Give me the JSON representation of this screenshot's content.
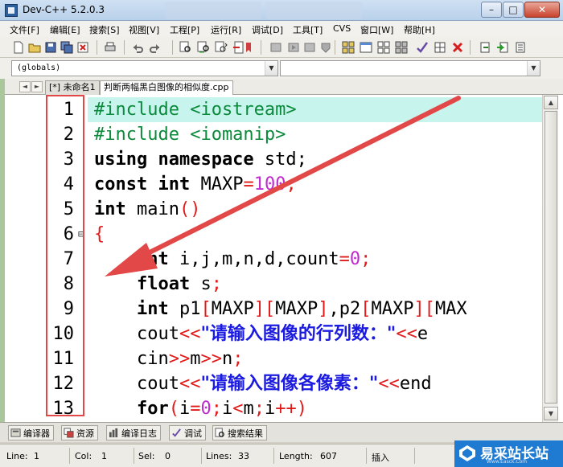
{
  "window": {
    "title": "Dev-C++ 5.2.0.3",
    "controls": {
      "minimize": "–",
      "maximize": "□",
      "close": "✕"
    }
  },
  "menu": [
    "文件[F]",
    "编辑[E]",
    "搜索[S]",
    "视图[V]",
    "工程[P]",
    "运行[R]",
    "调试[D]",
    "工具[T]",
    "CVS",
    "窗口[W]",
    "帮助[H]"
  ],
  "toolbar_icons": [
    "new-file-icon",
    "open-file-icon",
    "save-icon",
    "save-all-icon",
    "close-file-icon",
    "print-icon",
    "undo-icon",
    "redo-icon",
    "find-icon",
    "replace-icon",
    "find-next-icon",
    "goto-line-icon",
    "compile-icon",
    "run-icon",
    "compile-run-icon",
    "rebuild-icon",
    "new-project-icon",
    "add-file-icon",
    "remove-file-icon",
    "project-options-icon",
    "check-icon",
    "stop-icon",
    "debug-icon",
    "add-watch-icon",
    "view-cpu-icon"
  ],
  "scope": {
    "left_value": "(globals)",
    "right_value": ""
  },
  "tabs": [
    {
      "label": "[*] 未命名1",
      "active": false
    },
    {
      "label": "判断两幅黑白图像的相似度.cpp",
      "active": true
    }
  ],
  "editor": {
    "line_numbers": [
      "1",
      "2",
      "3",
      "4",
      "5",
      "6",
      "7",
      "8",
      "9",
      "10",
      "11",
      "12",
      "13"
    ],
    "fold_marker": "⊟",
    "lines": [
      [
        {
          "t": "#include <iostream>",
          "c": "pre"
        }
      ],
      [
        {
          "t": "#include <iomanip>",
          "c": "pre"
        }
      ],
      [
        {
          "t": "using namespace",
          "c": "kw"
        },
        {
          "t": " std;",
          "c": "id"
        }
      ],
      [
        {
          "t": "const int",
          "c": "kw"
        },
        {
          "t": " MAXP",
          "c": "id"
        },
        {
          "t": "=",
          "c": "op"
        },
        {
          "t": "100",
          "c": "num"
        },
        {
          "t": ";",
          "c": "op"
        }
      ],
      [
        {
          "t": "int",
          "c": "kw"
        },
        {
          "t": " main",
          "c": "id"
        },
        {
          "t": "()",
          "c": "op"
        }
      ],
      [
        {
          "t": "{",
          "c": "op"
        }
      ],
      [
        {
          "t": "    ",
          "c": "id"
        },
        {
          "t": "int",
          "c": "kw"
        },
        {
          "t": " i,j,m,n,d,count",
          "c": "id"
        },
        {
          "t": "=",
          "c": "op"
        },
        {
          "t": "0",
          "c": "num"
        },
        {
          "t": ";",
          "c": "op"
        }
      ],
      [
        {
          "t": "    ",
          "c": "id"
        },
        {
          "t": "float",
          "c": "kw"
        },
        {
          "t": " s",
          "c": "id"
        },
        {
          "t": ";",
          "c": "op"
        }
      ],
      [
        {
          "t": "    ",
          "c": "id"
        },
        {
          "t": "int",
          "c": "kw"
        },
        {
          "t": " p1",
          "c": "id"
        },
        {
          "t": "[",
          "c": "op"
        },
        {
          "t": "MAXP",
          "c": "id"
        },
        {
          "t": "][",
          "c": "op"
        },
        {
          "t": "MAXP",
          "c": "id"
        },
        {
          "t": "]",
          "c": "op"
        },
        {
          "t": ",p2",
          "c": "id"
        },
        {
          "t": "[",
          "c": "op"
        },
        {
          "t": "MAXP",
          "c": "id"
        },
        {
          "t": "][",
          "c": "op"
        },
        {
          "t": "MAX",
          "c": "id"
        }
      ],
      [
        {
          "t": "    cout",
          "c": "id"
        },
        {
          "t": "<<",
          "c": "op"
        },
        {
          "t": "\"请输入图像的行列数：\"",
          "c": "str"
        },
        {
          "t": "<<",
          "c": "op"
        },
        {
          "t": "e",
          "c": "id"
        }
      ],
      [
        {
          "t": "    cin",
          "c": "id"
        },
        {
          "t": ">>",
          "c": "op"
        },
        {
          "t": "m",
          "c": "id"
        },
        {
          "t": ">>",
          "c": "op"
        },
        {
          "t": "n",
          "c": "id"
        },
        {
          "t": ";",
          "c": "op"
        }
      ],
      [
        {
          "t": "    cout",
          "c": "id"
        },
        {
          "t": "<<",
          "c": "op"
        },
        {
          "t": "\"请输入图像各像素：\"",
          "c": "str"
        },
        {
          "t": "<<",
          "c": "op"
        },
        {
          "t": "end",
          "c": "id"
        }
      ],
      [
        {
          "t": "    for",
          "c": "kw"
        },
        {
          "t": "(",
          "c": "op"
        },
        {
          "t": "i",
          "c": "id"
        },
        {
          "t": "=",
          "c": "op"
        },
        {
          "t": "0",
          "c": "num"
        },
        {
          "t": ";",
          "c": "op"
        },
        {
          "t": "i",
          "c": "id"
        },
        {
          "t": "<",
          "c": "op"
        },
        {
          "t": "m",
          "c": "id"
        },
        {
          "t": ";",
          "c": "op"
        },
        {
          "t": "i",
          "c": "id"
        },
        {
          "t": "++)",
          "c": "op"
        }
      ]
    ]
  },
  "bottom_tabs": [
    {
      "label": "编译器",
      "icon": "compiler-icon"
    },
    {
      "label": "资源",
      "icon": "resource-icon"
    },
    {
      "label": "编译日志",
      "icon": "compile-log-icon"
    },
    {
      "label": "调试",
      "icon": "debug-check-icon"
    },
    {
      "label": "搜索结果",
      "icon": "search-results-icon"
    }
  ],
  "status": {
    "line_label": "Line:",
    "line_value": "1",
    "col_label": "Col:",
    "col_value": "1",
    "sel_label": "Sel:",
    "sel_value": "0",
    "lines_label": "Lines:",
    "lines_value": "33",
    "length_label": "Length:",
    "length_value": "607",
    "mode": "插入"
  },
  "watermark": {
    "text": "易采站长站",
    "url": "Www.Easck.Com"
  },
  "colors": {
    "active_line": "#c8f4ee",
    "preprocessor": "#0b8a3b",
    "operator": "#e11a1a",
    "number": "#c02ad0",
    "string": "#1a1ae0",
    "annotation": "#e24848"
  }
}
